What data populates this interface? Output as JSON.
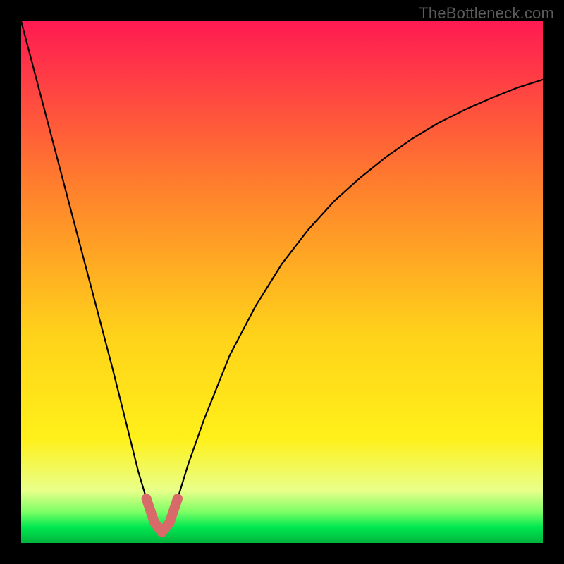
{
  "watermark": "TheBottleneck.com",
  "colors": {
    "background": "#000000",
    "watermark_text": "#5c5c5c",
    "curve": "#000000",
    "highlight_stroke": "#d96a6a",
    "gradient_top": "#ff1a52",
    "gradient_mid_upper": "#ff7a2e",
    "gradient_mid": "#ffd21a",
    "gradient_mid_lower": "#fff01a",
    "gradient_band": "#e8ff8a",
    "gradient_green": "#00e850",
    "gradient_green_dark": "#00b53e"
  },
  "chart_data": {
    "type": "line",
    "title": "",
    "xlabel": "",
    "ylabel": "",
    "x_range": [
      0,
      1
    ],
    "y_range": [
      0,
      1
    ],
    "minimum_x": 0.27,
    "series": [
      {
        "name": "bottleneck-curve",
        "x": [
          0.0,
          0.025,
          0.05,
          0.075,
          0.1,
          0.125,
          0.15,
          0.175,
          0.2,
          0.225,
          0.24,
          0.255,
          0.27,
          0.285,
          0.3,
          0.32,
          0.35,
          0.4,
          0.45,
          0.5,
          0.55,
          0.6,
          0.65,
          0.7,
          0.75,
          0.8,
          0.85,
          0.9,
          0.95,
          1.0
        ],
        "y": [
          1.0,
          0.905,
          0.81,
          0.715,
          0.62,
          0.525,
          0.43,
          0.335,
          0.235,
          0.135,
          0.085,
          0.04,
          0.02,
          0.04,
          0.085,
          0.15,
          0.235,
          0.36,
          0.455,
          0.535,
          0.6,
          0.655,
          0.7,
          0.74,
          0.775,
          0.805,
          0.83,
          0.852,
          0.872,
          0.888
        ]
      }
    ],
    "highlight_region_x": [
      0.235,
      0.305
    ],
    "gradient_stops_y": [
      {
        "y": 1.0,
        "color": "#ff1a52"
      },
      {
        "y": 0.7,
        "color": "#ff7a2e"
      },
      {
        "y": 0.4,
        "color": "#ffd21a"
      },
      {
        "y": 0.2,
        "color": "#fff01a"
      },
      {
        "y": 0.1,
        "color": "#e8ff8a"
      },
      {
        "y": 0.06,
        "color": "#7eff66"
      },
      {
        "y": 0.03,
        "color": "#00e850"
      },
      {
        "y": 0.0,
        "color": "#00b53e"
      }
    ]
  }
}
